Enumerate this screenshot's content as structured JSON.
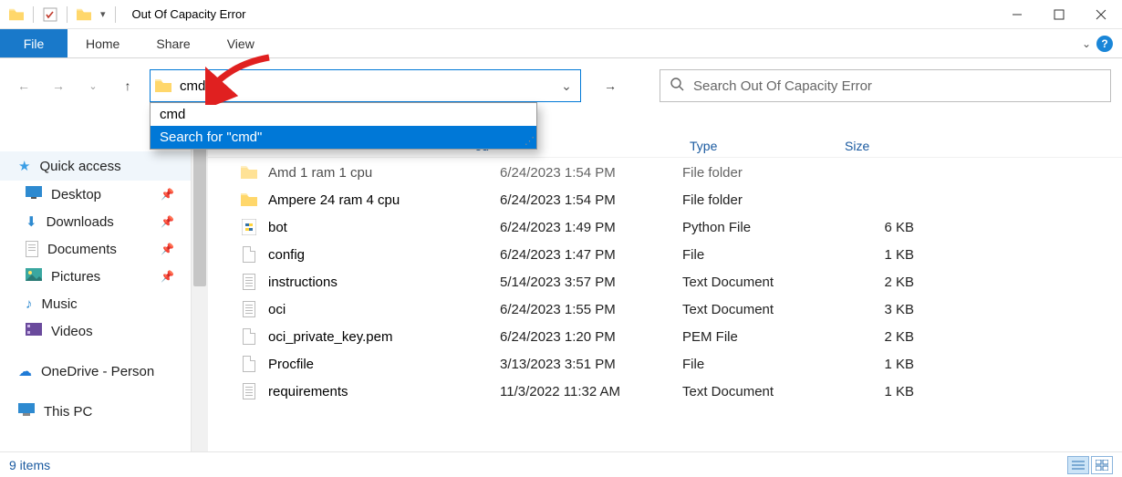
{
  "window": {
    "title": "Out Of Capacity Error"
  },
  "ribbon": {
    "file_label": "File",
    "tabs": [
      "Home",
      "Share",
      "View"
    ]
  },
  "address": {
    "input_value": "cmd",
    "dropdown": {
      "item0": "cmd",
      "item1": "Search for \"cmd\""
    }
  },
  "search": {
    "placeholder": "Search Out Of Capacity Error"
  },
  "columns": {
    "name_partial": "ed",
    "date": "",
    "type": "Type",
    "size": "Size"
  },
  "sidebar": {
    "quick_access": "Quick access",
    "items": [
      {
        "label": "Desktop",
        "pinned": true
      },
      {
        "label": "Downloads",
        "pinned": true
      },
      {
        "label": "Documents",
        "pinned": true
      },
      {
        "label": "Pictures",
        "pinned": true
      },
      {
        "label": "Music",
        "pinned": false
      },
      {
        "label": "Videos",
        "pinned": false
      }
    ],
    "onedrive": "OneDrive - Person",
    "this_pc": "This PC"
  },
  "files": [
    {
      "icon": "folder",
      "name": "Amd 1 ram 1 cpu",
      "date": "6/24/2023 1:54 PM",
      "type": "File folder",
      "size": ""
    },
    {
      "icon": "folder",
      "name": "Ampere 24 ram 4 cpu",
      "date": "6/24/2023 1:54 PM",
      "type": "File folder",
      "size": ""
    },
    {
      "icon": "python",
      "name": "bot",
      "date": "6/24/2023 1:49 PM",
      "type": "Python File",
      "size": "6 KB"
    },
    {
      "icon": "blank",
      "name": "config",
      "date": "6/24/2023 1:47 PM",
      "type": "File",
      "size": "1 KB"
    },
    {
      "icon": "text",
      "name": "instructions",
      "date": "5/14/2023 3:57 PM",
      "type": "Text Document",
      "size": "2 KB"
    },
    {
      "icon": "text",
      "name": "oci",
      "date": "6/24/2023 1:55 PM",
      "type": "Text Document",
      "size": "3 KB"
    },
    {
      "icon": "blank",
      "name": "oci_private_key.pem",
      "date": "6/24/2023 1:20 PM",
      "type": "PEM File",
      "size": "2 KB"
    },
    {
      "icon": "blank",
      "name": "Procfile",
      "date": "3/13/2023 3:51 PM",
      "type": "File",
      "size": "1 KB"
    },
    {
      "icon": "text",
      "name": "requirements",
      "date": "11/3/2022 11:32 AM",
      "type": "Text Document",
      "size": "1 KB"
    }
  ],
  "status": {
    "items_text": "9 items"
  }
}
